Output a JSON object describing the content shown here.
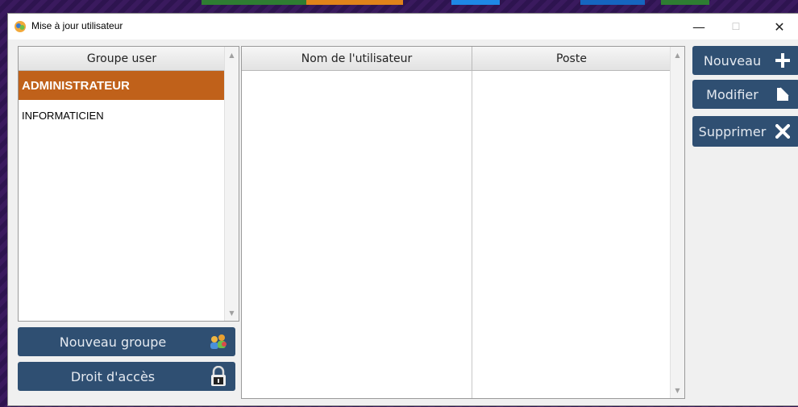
{
  "window": {
    "title": "Mise à jour utilisateur",
    "controls": {
      "minimize": "—",
      "maximize": "☐",
      "close": "✕"
    }
  },
  "groups": {
    "header": "Groupe user",
    "items": [
      {
        "label": "ADMINISTRATEUR",
        "selected": true
      },
      {
        "label": "INFORMATICIEN",
        "selected": false
      }
    ]
  },
  "users": {
    "columns": [
      "Nom de l'utilisateur",
      "Poste"
    ],
    "rows": []
  },
  "actions": {
    "new_label": "Nouveau",
    "edit_label": "Modifier",
    "delete_label": "Supprimer",
    "new_group_label": "Nouveau groupe",
    "access_rights_label": "Droit d'accès"
  },
  "colors": {
    "selected_row": "#c0611a",
    "button_bg": "#2f4f72",
    "button_text": "#e4e9f0"
  },
  "icons": [
    "app-icon",
    "plus-icon",
    "edit-document-icon",
    "close-x-icon",
    "users-group-icon",
    "padlock-icon"
  ]
}
